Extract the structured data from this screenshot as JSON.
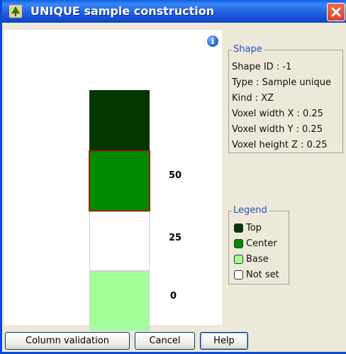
{
  "window": {
    "title": "UNIQUE sample construction"
  },
  "canvas": {
    "y_labels": [
      "50",
      "25",
      "0"
    ],
    "colors": {
      "top": "#023800",
      "center": "#008a00",
      "base": "#a0ff98",
      "not_set": "#ffffff",
      "center_border": "#8b2a10"
    }
  },
  "shape": {
    "group_title": "Shape",
    "lines": [
      "Shape ID : -1",
      "Type : Sample unique",
      "Kind : XZ",
      "Voxel width X : 0.25",
      "Voxel width Y : 0.25",
      "Voxel height Z : 0.25"
    ]
  },
  "legend": {
    "group_title": "Legend",
    "items": [
      {
        "label": "Top",
        "color": "#023800"
      },
      {
        "label": "Center",
        "color": "#008a00"
      },
      {
        "label": "Base",
        "color": "#a0ff98"
      },
      {
        "label": "Not set",
        "color": "#ffffff"
      }
    ]
  },
  "buttons": {
    "column_validation": "Column validation",
    "cancel": "Cancel",
    "help": "Help"
  },
  "icons": {
    "title": "tree-icon",
    "info": "info-icon",
    "close": "close-icon"
  }
}
